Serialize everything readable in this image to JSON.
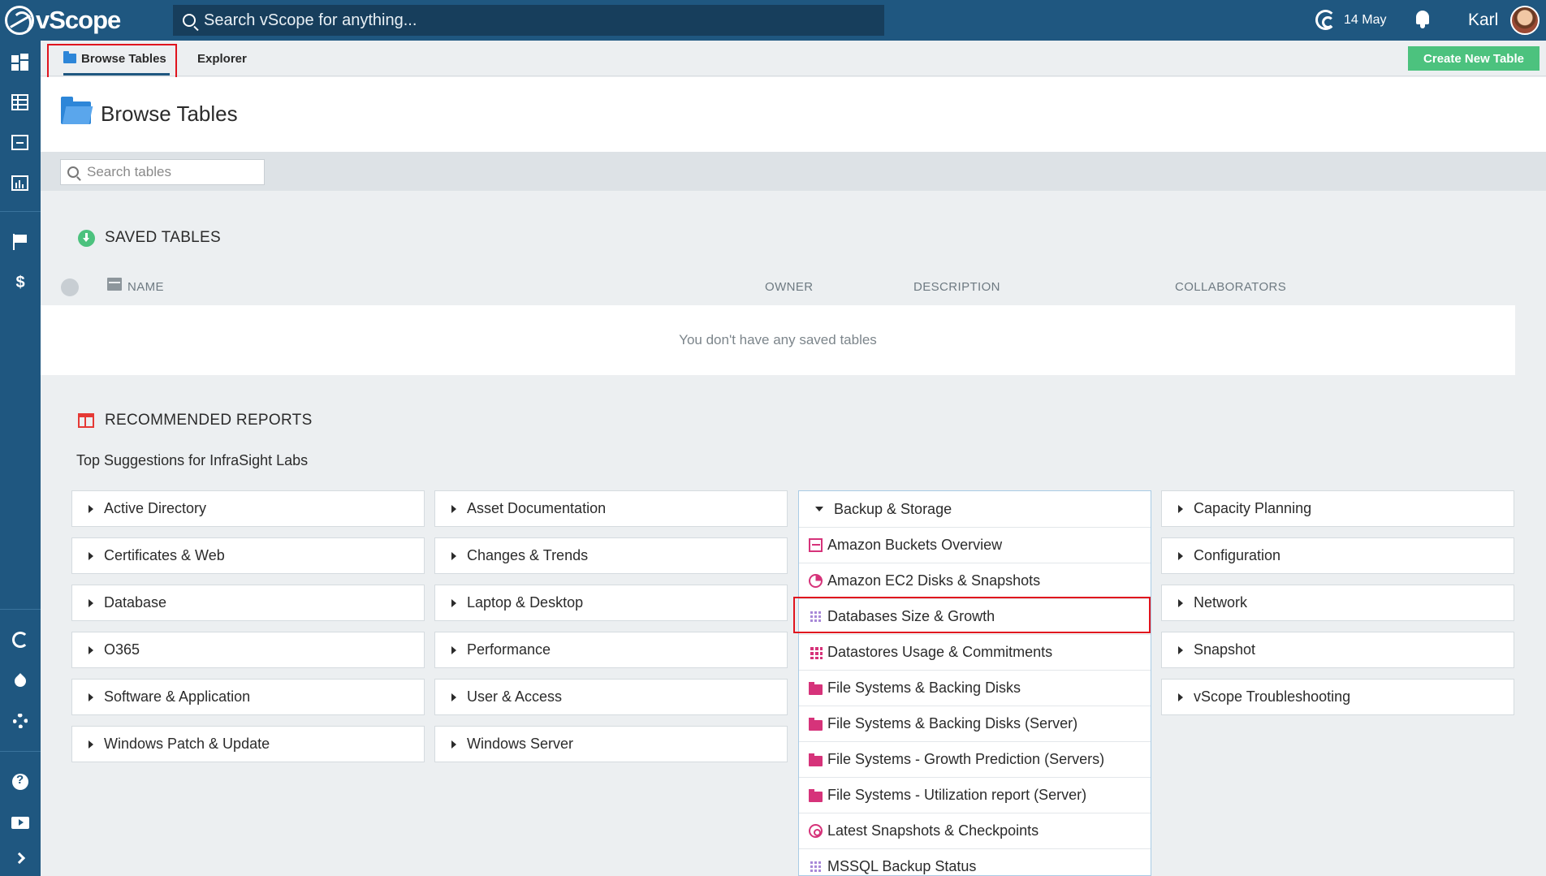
{
  "topbar": {
    "logo_text": "vScope",
    "search_placeholder": "Search vScope for anything...",
    "date": "14 May",
    "user": "Karl"
  },
  "tabs": {
    "browse": "Browse Tables",
    "explorer": "Explorer",
    "create_button": "Create New Table"
  },
  "page": {
    "title": "Browse Tables",
    "search_placeholder": "Search tables"
  },
  "saved": {
    "heading": "SAVED TABLES",
    "columns": {
      "name": "NAME",
      "owner": "OWNER",
      "description": "DESCRIPTION",
      "collaborators": "COLLABORATORS"
    },
    "empty_message": "You don't have any saved tables"
  },
  "recommended": {
    "heading": "RECOMMENDED REPORTS",
    "subtitle": "Top Suggestions for InfraSight Labs",
    "col1": [
      "Active Directory",
      "Certificates & Web",
      "Database",
      "O365",
      "Software & Application",
      "Windows Patch & Update"
    ],
    "col2": [
      "Asset Documentation",
      "Changes & Trends",
      "Laptop & Desktop",
      "Performance",
      "User & Access",
      "Windows Server"
    ],
    "expanded": {
      "label": "Backup & Storage",
      "items": [
        {
          "label": "Amazon Buckets Overview",
          "icon": "bucket-icon"
        },
        {
          "label": "Amazon EC2 Disks & Snapshots",
          "icon": "pie-icon"
        },
        {
          "label": "Databases Size & Growth",
          "icon": "table-icon"
        },
        {
          "label": "Datastores Usage & Commitments",
          "icon": "grid-icon"
        },
        {
          "label": "File Systems & Backing Disks",
          "icon": "folder-icon"
        },
        {
          "label": "File Systems & Backing Disks (Server)",
          "icon": "folder-icon"
        },
        {
          "label": "File Systems - Growth Prediction (Servers)",
          "icon": "folder-icon"
        },
        {
          "label": "File Systems - Utilization report (Server)",
          "icon": "folder-icon"
        },
        {
          "label": "Latest Snapshots & Checkpoints",
          "icon": "camera-icon"
        },
        {
          "label": "MSSQL Backup Status",
          "icon": "table-icon"
        }
      ]
    },
    "col4": [
      "Capacity Planning",
      "Configuration",
      "Network",
      "Snapshot",
      "vScope Troubleshooting"
    ]
  },
  "colors": {
    "primary": "#1f5780",
    "accent_green": "#4cc27e",
    "highlight_red": "#e0141e",
    "report_pink": "#d6337a"
  }
}
